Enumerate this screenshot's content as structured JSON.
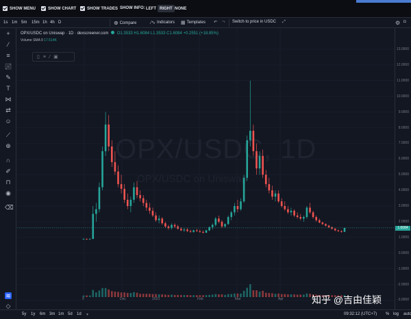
{
  "topbar": {
    "show_menu": "SHOW MENU",
    "show_chart": "SHOW CHART",
    "show_trades": "SHOW TRADES",
    "show_info": "SHOW INFO:",
    "left": "LEFT",
    "right": "RIGHT",
    "none": "NONE",
    "active_info": "RIGHT"
  },
  "toolbar": {
    "timeframes": [
      "1s",
      "1m",
      "5m",
      "15m",
      "1h",
      "4h",
      "D"
    ],
    "compare": "Compare",
    "indicators": "Indicators",
    "templates": "Templates",
    "switch_price": "Switch to price in USDC"
  },
  "legend": {
    "symbol": "OPX/USDC on Uniswap · 1D · dexscreener.com",
    "ohlc": "O1.3533 H1.6084 L1.3533 C1.6084 +0.2551 (+18.85%)",
    "volume": "Volume SMA 9",
    "volume_value": "17.514K"
  },
  "watermark": {
    "main": "OPX/USDC, 1D",
    "sub": "OPX/USDC on Uniswap"
  },
  "price_axis": [
    "13.0000",
    "12.0000",
    "11.0000",
    "10.0000",
    "9.0000",
    "8.0000",
    "7.0000",
    "6.0000",
    "5.0000",
    "4.0000",
    "3.0000",
    "2.0000",
    "1.0000",
    "0.0000",
    "-1.0000",
    "-2.0000",
    "-3.0000",
    "-4.0000"
  ],
  "current_price": "1.6084",
  "time_axis": [
    "9",
    "Dec",
    "2023",
    "Feb",
    "Mar",
    "Apr"
  ],
  "bottombar": {
    "ranges": [
      "5y",
      "1y",
      "6m",
      "3m",
      "1m",
      "5d",
      "1d"
    ],
    "clock": "09:32:12 (UTC+7)",
    "pct": "%",
    "log": "log",
    "auto": "auto"
  },
  "brand_watermark": "知乎 @吉由佳颖",
  "colors": {
    "up": "#26a69a",
    "down": "#ef5350",
    "bg": "#131722"
  },
  "chart_data": {
    "type": "candlestick",
    "title": "OPX/USDC on Uniswap · 1D · dexscreener.com",
    "ylim": [
      -4,
      13
    ],
    "candles": [
      [
        0.9,
        0.95,
        0.85,
        0.9
      ],
      [
        0.9,
        0.95,
        0.85,
        0.88
      ],
      [
        0.88,
        0.95,
        0.85,
        0.9
      ],
      [
        0.9,
        3.0,
        0.9,
        2.5
      ],
      [
        2.5,
        3.2,
        2.0,
        2.8
      ],
      [
        2.8,
        4.5,
        2.6,
        4.2
      ],
      [
        4.2,
        6.8,
        4.0,
        6.5
      ],
      [
        6.5,
        9.0,
        6.2,
        8.2
      ],
      [
        8.2,
        8.8,
        6.5,
        6.8
      ],
      [
        6.8,
        7.2,
        5.5,
        5.8
      ],
      [
        5.8,
        6.5,
        5.0,
        5.2
      ],
      [
        5.2,
        5.6,
        4.2,
        4.4
      ],
      [
        4.4,
        5.0,
        3.8,
        4.1
      ],
      [
        4.1,
        4.4,
        3.2,
        3.4
      ],
      [
        3.4,
        3.8,
        2.8,
        3.0
      ],
      [
        3.0,
        3.6,
        2.6,
        3.4
      ],
      [
        3.4,
        4.5,
        3.2,
        4.2
      ],
      [
        4.2,
        4.6,
        3.5,
        3.7
      ],
      [
        3.7,
        4.0,
        3.3,
        3.5
      ],
      [
        3.5,
        3.7,
        3.0,
        3.2
      ],
      [
        3.2,
        3.4,
        2.7,
        2.9
      ],
      [
        2.9,
        3.2,
        2.5,
        2.7
      ],
      [
        2.7,
        2.9,
        2.3,
        2.4
      ],
      [
        2.4,
        2.6,
        2.0,
        2.1
      ],
      [
        2.1,
        2.4,
        1.9,
        2.2
      ],
      [
        2.2,
        2.3,
        1.8,
        1.9
      ],
      [
        1.9,
        2.0,
        1.6,
        1.7
      ],
      [
        1.7,
        1.8,
        1.5,
        1.6
      ],
      [
        1.6,
        1.9,
        1.5,
        1.8
      ],
      [
        1.8,
        1.9,
        1.6,
        1.7
      ],
      [
        1.7,
        1.8,
        1.5,
        1.55
      ],
      [
        1.55,
        1.65,
        1.4,
        1.45
      ],
      [
        1.45,
        1.6,
        1.35,
        1.5
      ],
      [
        1.5,
        1.6,
        1.35,
        1.4
      ],
      [
        1.4,
        1.5,
        1.3,
        1.35
      ],
      [
        1.35,
        1.5,
        1.3,
        1.45
      ],
      [
        1.45,
        1.55,
        1.35,
        1.4
      ],
      [
        1.4,
        1.5,
        1.3,
        1.35
      ],
      [
        1.35,
        1.45,
        1.25,
        1.3
      ],
      [
        1.3,
        1.5,
        1.28,
        1.45
      ],
      [
        1.45,
        1.7,
        1.4,
        1.65
      ],
      [
        1.65,
        1.9,
        1.5,
        1.8
      ],
      [
        1.8,
        2.3,
        1.7,
        2.2
      ],
      [
        2.2,
        2.4,
        1.9,
        2.0
      ],
      [
        2.0,
        2.1,
        1.6,
        1.7
      ],
      [
        1.7,
        1.9,
        1.6,
        1.85
      ],
      [
        1.85,
        2.4,
        1.8,
        2.3
      ],
      [
        2.3,
        2.7,
        2.1,
        2.6
      ],
      [
        2.6,
        3.2,
        2.4,
        3.0
      ],
      [
        3.0,
        3.4,
        2.6,
        2.8
      ],
      [
        2.8,
        3.5,
        2.7,
        3.3
      ],
      [
        3.3,
        5.0,
        3.2,
        4.8
      ],
      [
        4.8,
        7.5,
        4.6,
        7.2
      ],
      [
        7.2,
        11.0,
        6.8,
        7.8
      ],
      [
        7.8,
        8.2,
        6.2,
        6.5
      ],
      [
        6.5,
        7.0,
        5.0,
        5.4
      ],
      [
        5.4,
        6.5,
        5.0,
        6.2
      ],
      [
        6.2,
        6.6,
        4.8,
        5.0
      ],
      [
        5.0,
        5.3,
        4.2,
        4.4
      ],
      [
        4.4,
        4.8,
        3.8,
        4.0
      ],
      [
        4.0,
        4.3,
        3.4,
        3.6
      ],
      [
        3.6,
        4.0,
        3.3,
        3.8
      ],
      [
        3.8,
        4.0,
        3.2,
        3.3
      ],
      [
        3.3,
        3.5,
        2.9,
        3.0
      ],
      [
        3.0,
        3.3,
        2.7,
        2.8
      ],
      [
        2.8,
        3.0,
        2.5,
        2.6
      ],
      [
        2.6,
        2.9,
        2.4,
        2.7
      ],
      [
        2.7,
        2.8,
        2.3,
        2.4
      ],
      [
        2.4,
        2.6,
        2.2,
        2.3
      ],
      [
        2.3,
        2.5,
        2.1,
        2.2
      ],
      [
        2.2,
        2.4,
        2.0,
        2.3
      ],
      [
        2.3,
        3.0,
        2.2,
        2.9
      ],
      [
        2.9,
        3.2,
        2.5,
        2.6
      ],
      [
        2.6,
        2.7,
        2.2,
        2.3
      ],
      [
        2.3,
        2.4,
        2.0,
        2.1
      ],
      [
        2.1,
        2.2,
        1.9,
        1.95
      ],
      [
        1.95,
        2.0,
        1.8,
        1.85
      ],
      [
        1.85,
        1.9,
        1.7,
        1.75
      ],
      [
        1.75,
        1.8,
        1.6,
        1.65
      ],
      [
        1.65,
        1.7,
        1.5,
        1.55
      ],
      [
        1.55,
        1.6,
        1.4,
        1.45
      ],
      [
        1.45,
        1.5,
        1.35,
        1.4
      ],
      [
        1.4,
        1.45,
        1.3,
        1.35
      ],
      [
        1.3533,
        1.6084,
        1.3533,
        1.6084
      ]
    ]
  }
}
